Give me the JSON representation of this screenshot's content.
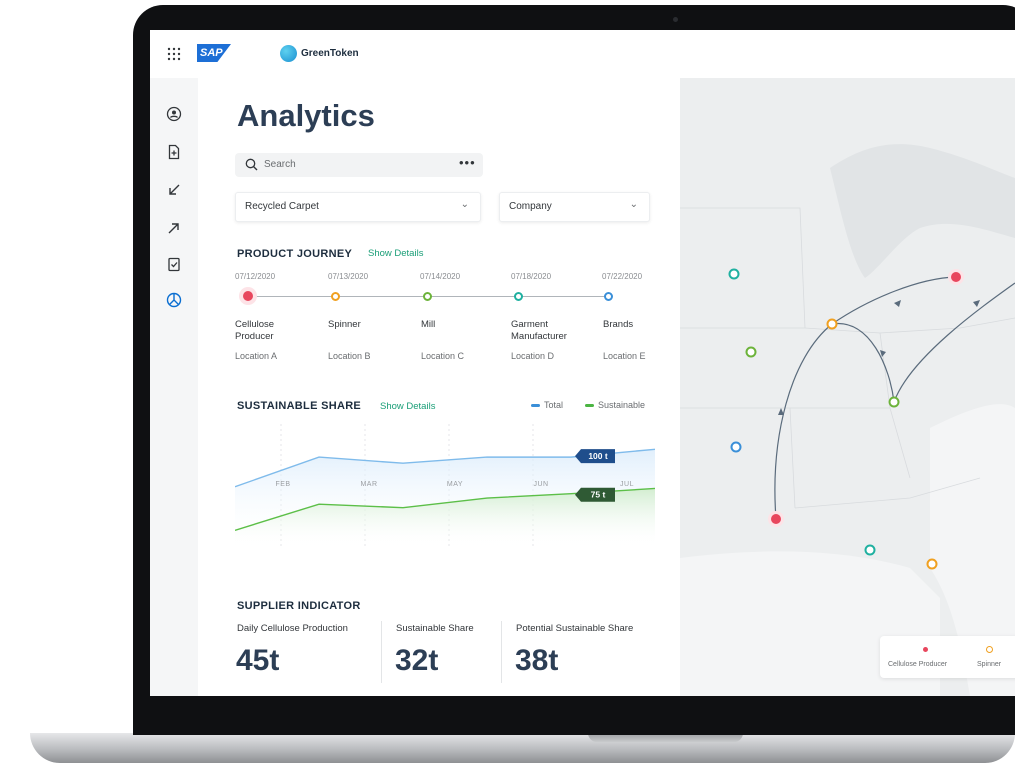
{
  "app": {
    "brand": "SAP",
    "product_name": "GreenToken"
  },
  "page_title": "Analytics",
  "search": {
    "placeholder": "Search"
  },
  "filters": {
    "product": "Recycled Carpet",
    "company": "Company"
  },
  "product_journey": {
    "title": "PRODUCT JOURNEY",
    "link": "Show Details",
    "steps": [
      {
        "date": "07/12/2020",
        "name_line1": "Cellulose",
        "name_line2": "Producer",
        "location": "Location A",
        "color": "#e8465d"
      },
      {
        "date": "07/13/2020",
        "name_line1": "Spinner",
        "name_line2": "",
        "location": "Location B",
        "color": "#f0a020"
      },
      {
        "date": "07/14/2020",
        "name_line1": "Mill",
        "name_line2": "",
        "location": "Location C",
        "color": "#6cb33a"
      },
      {
        "date": "07/18/2020",
        "name_line1": "Garment",
        "name_line2": "Manufacturer",
        "location": "Location D",
        "color": "#1fb0a0"
      },
      {
        "date": "07/22/2020",
        "name_line1": "Brands",
        "name_line2": "",
        "location": "Location E",
        "color": "#3a8fd8"
      }
    ]
  },
  "sustainable_share": {
    "title": "SUSTAINABLE SHARE",
    "link": "Show Details",
    "legend": [
      {
        "label": "Total",
        "color": "#3a8fd8"
      },
      {
        "label": "Sustainable",
        "color": "#4bb543"
      }
    ]
  },
  "chart_data": {
    "type": "area",
    "categories": [
      "",
      "FEB",
      "MAR",
      "MAY",
      "JUN",
      "JUL"
    ],
    "series": [
      {
        "name": "Total",
        "values": [
          68,
          102,
          95,
          102,
          102,
          111
        ]
      },
      {
        "name": "Sustainable",
        "values": [
          18,
          48,
          44,
          55,
          60,
          66
        ]
      }
    ],
    "annotations": [
      {
        "label": "100 t",
        "series": "Total"
      },
      {
        "label": "75 t",
        "series": "Sustainable"
      }
    ],
    "ylim": [
      0,
      140
    ],
    "grid": true
  },
  "supplier_indicator": {
    "title": "SUPPLIER INDICATOR",
    "kpis": [
      {
        "label": "Daily Cellulose Production",
        "value": "45t"
      },
      {
        "label": "Sustainable Share",
        "value": "32t"
      },
      {
        "label": "Potential Sustainable Share",
        "value": "38t"
      }
    ]
  },
  "map": {
    "legend": [
      {
        "label": "Cellulose Producer",
        "color": "#e8465d"
      },
      {
        "label": "Spinner",
        "color": "#f0a020"
      }
    ]
  }
}
